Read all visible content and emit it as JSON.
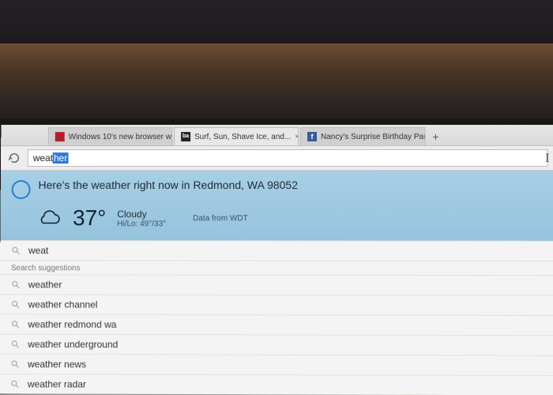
{
  "tabs": [
    {
      "label": "Windows 10's new browser w...",
      "favicon": "v"
    },
    {
      "label": "Surf, Sun, Shave Ice, and...",
      "favicon": "ba"
    },
    {
      "label": "Nancy's Surprise Birthday Par...",
      "favicon": "fb"
    }
  ],
  "address": {
    "typed": "weat",
    "selected": "her"
  },
  "right_letter": "I",
  "cortana": {
    "headline": "Here's the weather right now in Redmond, WA 98052",
    "temp": "37°",
    "condition": "Cloudy",
    "hilo": "Hi/Lo: 49°/33°",
    "source": "Data from WDT"
  },
  "suggestions": {
    "top": "weat",
    "section_label": "Search suggestions",
    "items": [
      "weather",
      "weather channel",
      "weather redmond wa",
      "weather underground",
      "weather news",
      "weather radar"
    ]
  }
}
